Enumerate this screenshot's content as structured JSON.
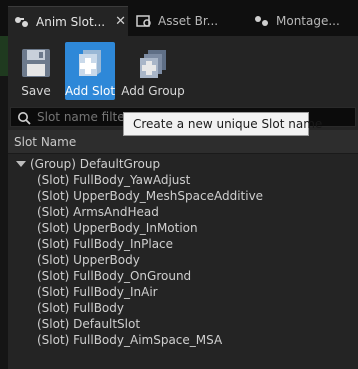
{
  "tabs": [
    {
      "label": "Anim Slot...",
      "icon": "anim-slot-icon",
      "active": true,
      "close": "✕"
    },
    {
      "label": "Asset Br...",
      "icon": "asset-browser-icon",
      "active": false
    },
    {
      "label": "Montage...",
      "icon": "montage-icon",
      "active": false
    }
  ],
  "toolbar": {
    "save_label": "Save",
    "add_slot_label": "Add Slot",
    "add_group_label": "Add Group"
  },
  "search": {
    "placeholder": "Slot name filter"
  },
  "column_header": "Slot Name",
  "tooltip": "Create a new unique Slot name",
  "tree": {
    "group_label": "(Group) DefaultGroup",
    "slots": [
      "(Slot) FullBody_YawAdjust",
      "(Slot) UpperBody_MeshSpaceAdditive",
      "(Slot) ArmsAndHead",
      "(Slot) UpperBody_InMotion",
      "(Slot) FullBody_InPlace",
      "(Slot) UpperBody",
      "(Slot) FullBody_OnGround",
      "(Slot) FullBody_InAir",
      "(Slot) FullBody",
      "(Slot) DefaultSlot",
      "(Slot) FullBody_AimSpace_MSA"
    ]
  },
  "colors": {
    "highlight": "#2e88d8",
    "panel": "#242424",
    "tooltip_bg": "#f2f2f2"
  }
}
